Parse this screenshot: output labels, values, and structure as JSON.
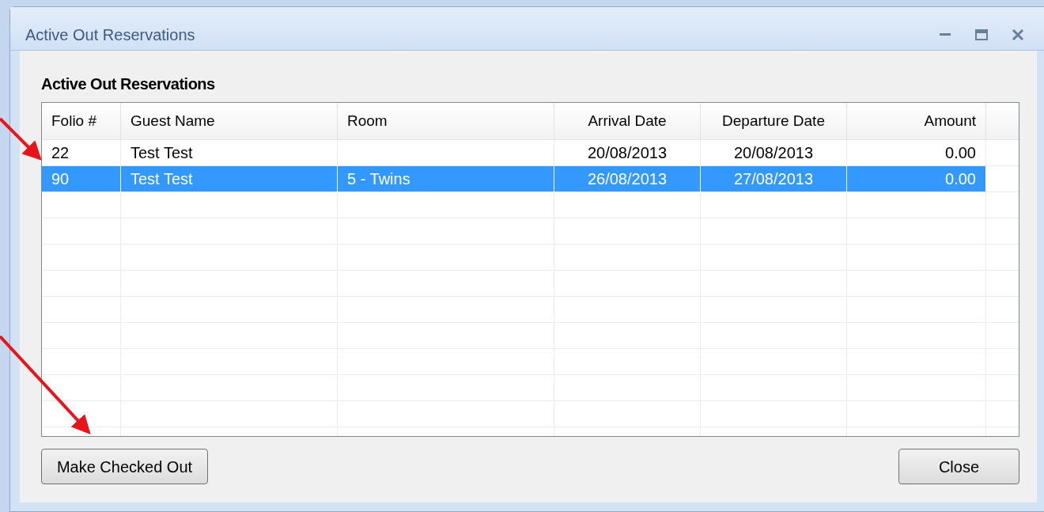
{
  "window": {
    "title": "Active Out Reservations"
  },
  "heading": "Active Out Reservations",
  "table": {
    "columns": [
      "Folio #",
      "Guest Name",
      "Room",
      "Arrival Date",
      "Departure Date",
      "Amount"
    ],
    "rows": [
      {
        "cells": [
          "22",
          "Test Test",
          "",
          "20/08/2013",
          "20/08/2013",
          "0.00"
        ],
        "selected": false
      },
      {
        "cells": [
          "90",
          "Test Test",
          "5 - Twins",
          "26/08/2013",
          "27/08/2013",
          "0.00"
        ],
        "selected": true
      }
    ]
  },
  "buttons": [
    "Make Checked Out",
    "Close"
  ]
}
